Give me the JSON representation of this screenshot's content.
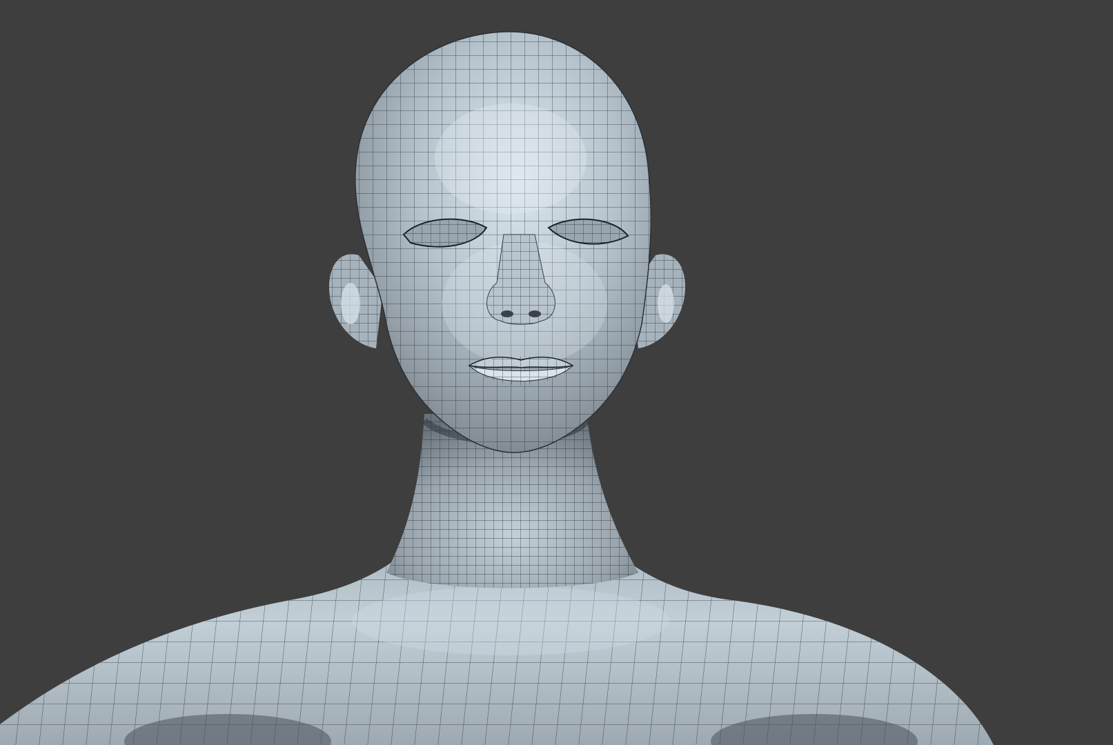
{
  "viewport": {
    "background_color": "#3e3e3e",
    "subject": "wireframe-sculpt-female-bust",
    "mesh_colors": {
      "base": "#b9c6d0",
      "highlight": "#dbe6ee",
      "shadow": "#5d6770",
      "wire": "#1c2228"
    },
    "wireframe_overlay": true
  }
}
